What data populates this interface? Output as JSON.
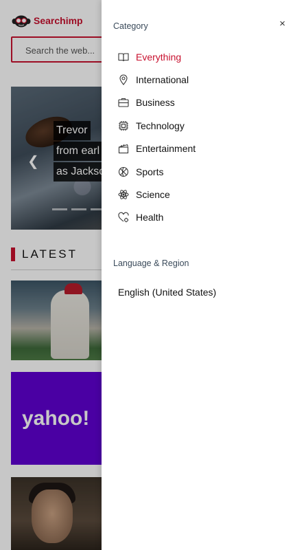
{
  "header": {
    "logo_text": "Searchimp",
    "search_placeholder": "Search the web..."
  },
  "hero": {
    "caption_lines": [
      "Trevor",
      "from earl",
      "as Jackso"
    ]
  },
  "latest": {
    "title": "LATEST"
  },
  "thumbnails": {
    "yahoo_logo": "yahoo!"
  },
  "drawer": {
    "category_title": "Category",
    "categories": [
      {
        "label": "Everything",
        "icon": "book-icon",
        "active": true
      },
      {
        "label": "International",
        "icon": "map-pin-icon",
        "active": false
      },
      {
        "label": "Business",
        "icon": "briefcase-icon",
        "active": false
      },
      {
        "label": "Technology",
        "icon": "chip-icon",
        "active": false
      },
      {
        "label": "Entertainment",
        "icon": "clapperboard-icon",
        "active": false
      },
      {
        "label": "Sports",
        "icon": "basketball-icon",
        "active": false
      },
      {
        "label": "Science",
        "icon": "atom-icon",
        "active": false
      },
      {
        "label": "Health",
        "icon": "heart-gear-icon",
        "active": false
      }
    ],
    "language_title": "Language & Region",
    "language_value": "English (United States)",
    "close_glyph": "×"
  },
  "colors": {
    "accent": "#c8102e",
    "yahoo_purple": "#5f01d1"
  }
}
